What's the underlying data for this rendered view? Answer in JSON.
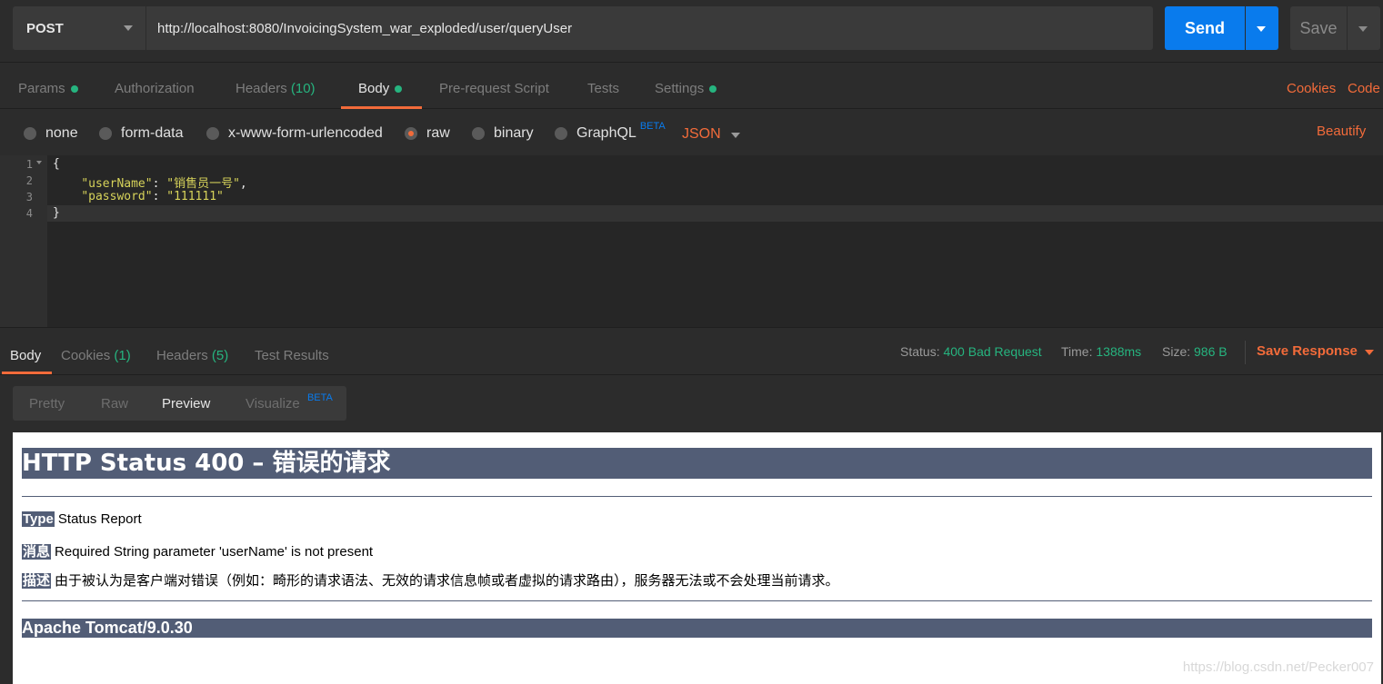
{
  "request": {
    "method": "POST",
    "url": "http://localhost:8080/InvoicingSystem_war_exploded/user/queryUser",
    "send_label": "Send",
    "save_label": "Save"
  },
  "request_tabs": {
    "params": "Params",
    "authorization": "Authorization",
    "headers": "Headers",
    "headers_count": "(10)",
    "body": "Body",
    "prerequest": "Pre-request Script",
    "tests": "Tests",
    "settings": "Settings",
    "cookies": "Cookies",
    "code": "Code"
  },
  "body_types": {
    "none": "none",
    "form_data": "form-data",
    "urlencoded": "x-www-form-urlencoded",
    "raw": "raw",
    "binary": "binary",
    "graphql": "GraphQL",
    "beta": "BETA",
    "format": "JSON",
    "beautify": "Beautify",
    "selected": "raw"
  },
  "editor": {
    "line_numbers": [
      "1",
      "2",
      "3",
      "4"
    ],
    "open_brace": "{",
    "close_brace": "}",
    "user_key": "\"userName\"",
    "user_value": "\"销售员一号\"",
    "pass_key": "\"password\"",
    "pass_value": "\"111111\""
  },
  "response_tabs": {
    "body": "Body",
    "cookies": "Cookies",
    "cookies_count": "(1)",
    "headers": "Headers",
    "headers_count": "(5)",
    "test_results": "Test Results"
  },
  "response_meta": {
    "status_label": "Status:",
    "status_value": "400 Bad Request",
    "time_label": "Time:",
    "time_value": "1388ms",
    "size_label": "Size:",
    "size_value": "986 B",
    "save_response": "Save Response"
  },
  "view_modes": {
    "pretty": "Pretty",
    "raw": "Raw",
    "preview": "Preview",
    "visualize": "Visualize",
    "beta": "BETA",
    "selected": "Preview"
  },
  "preview": {
    "title": "HTTP Status 400 – 错误的请求",
    "type_label": "Type",
    "type_value": "Status Report",
    "message_label": "消息",
    "message_value": "Required String parameter 'userName' is not present",
    "desc_label": "描述",
    "desc_value": "由于被认为是客户端对错误（例如：畸形的请求语法、无效的请求信息帧或者虚拟的请求路由），服务器无法或不会处理当前请求。",
    "footer": "Apache Tomcat/9.0.30",
    "watermark": "https://blog.csdn.net/Pecker007"
  },
  "colors": {
    "accent": "#f26b3a",
    "send": "#097bed",
    "success": "#26b47f",
    "tomcat_banner": "#525d76"
  }
}
